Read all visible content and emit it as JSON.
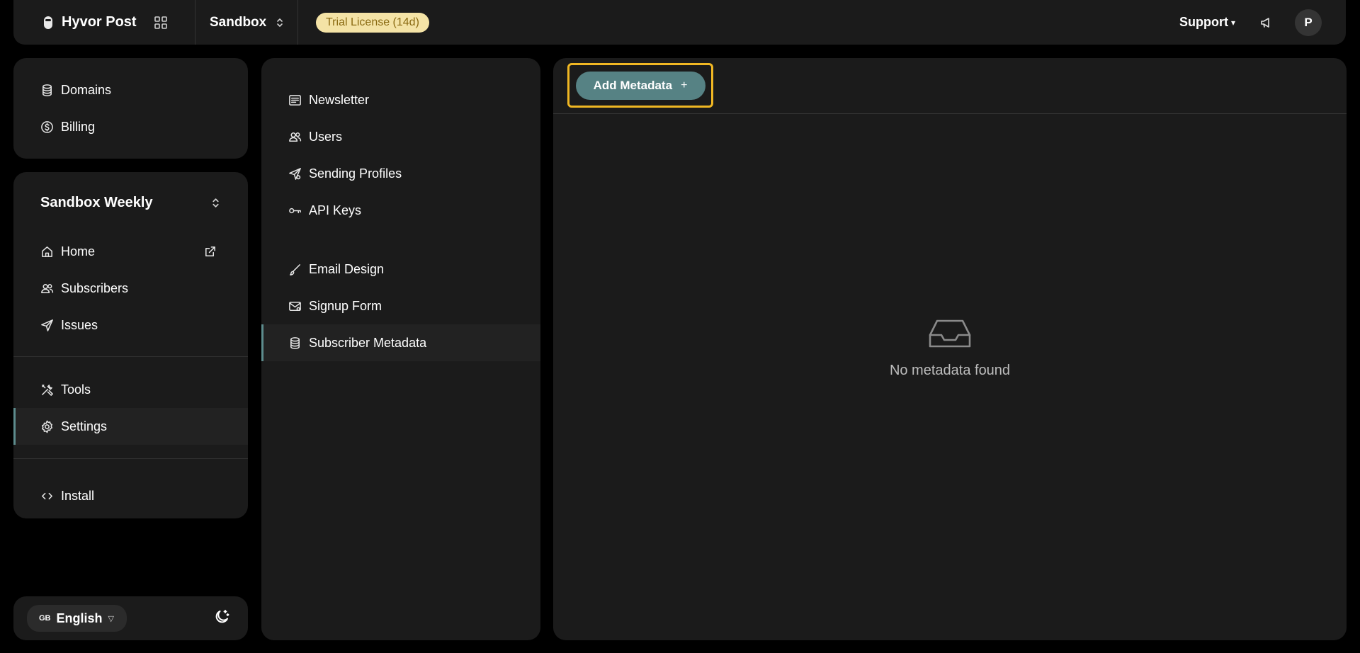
{
  "header": {
    "brand": "Hyvor Post",
    "workspace": "Sandbox",
    "trial_badge": "Trial License (14d)",
    "support_label": "Support",
    "avatar_initial": "P"
  },
  "sidebar_top": {
    "items": [
      {
        "label": "Domains",
        "icon": "database-icon"
      },
      {
        "label": "Billing",
        "icon": "dollar-circle-icon"
      }
    ]
  },
  "project": {
    "name": "Sandbox Weekly",
    "items": [
      {
        "label": "Home",
        "icon": "home-icon"
      },
      {
        "label": "Subscribers",
        "icon": "users-icon"
      },
      {
        "label": "Issues",
        "icon": "send-icon"
      }
    ],
    "tools_items": [
      {
        "label": "Tools",
        "icon": "tools-icon"
      },
      {
        "label": "Settings",
        "icon": "gear-icon",
        "active": true
      }
    ],
    "install_label": "Install"
  },
  "footer": {
    "flag": "GB",
    "language": "English"
  },
  "settings_nav": {
    "group1": [
      {
        "label": "Newsletter",
        "icon": "newsletter-icon"
      },
      {
        "label": "Users",
        "icon": "users-icon"
      },
      {
        "label": "Sending Profiles",
        "icon": "send-icon"
      },
      {
        "label": "API Keys",
        "icon": "key-icon"
      }
    ],
    "group2": [
      {
        "label": "Email Design",
        "icon": "brush-icon"
      },
      {
        "label": "Signup Form",
        "icon": "envelope-icon"
      },
      {
        "label": "Subscriber Metadata",
        "icon": "database-icon",
        "active": true
      }
    ]
  },
  "main": {
    "add_button_label": "Add Metadata",
    "add_button_symbol": "+",
    "empty_text": "No metadata found"
  },
  "colors": {
    "accent": "#568284",
    "highlight": "#f0b723",
    "trial_bg": "#f4e3a6",
    "panel_bg": "#1b1b1b"
  }
}
